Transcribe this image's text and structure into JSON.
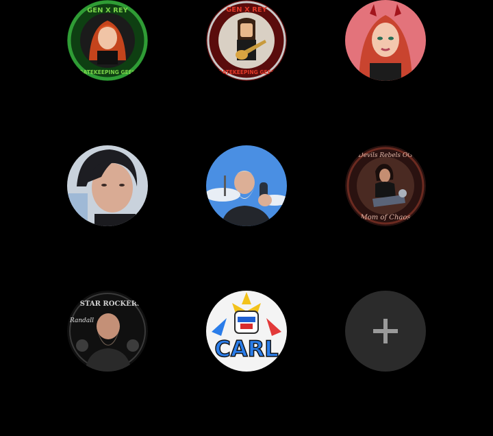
{
  "avatars": [
    {
      "id": "avatar-1",
      "icon": "green-badge-redhead-portrait",
      "ring_color": "#1f8f2a",
      "top_text": "GEN X REY",
      "bottom_text": "GATEKEEPING GEEK"
    },
    {
      "id": "avatar-2",
      "icon": "red-badge-guitarist-figure",
      "ring_color": "#b01a1a",
      "top_text": "GEN X REY",
      "bottom_text": "GATEKEEPING GEEK"
    },
    {
      "id": "avatar-3",
      "icon": "cartoon-devil-girl-portrait",
      "ring_color": "#d8646e"
    },
    {
      "id": "avatar-4",
      "icon": "woman-dark-hair-photo",
      "ring_color": "#bfc8d3"
    },
    {
      "id": "avatar-5",
      "icon": "bearded-man-blue-sky-photo",
      "ring_color": "#4b8fe0"
    },
    {
      "id": "avatar-6",
      "icon": "devils-rebels-badge",
      "ring_color": "#3a1a16",
      "top_text": "Devils Rebels OG",
      "bottom_text": "Mom of Chaos"
    },
    {
      "id": "avatar-7",
      "icon": "star-rockers-bald-man-badge",
      "ring_color": "#1e1e1e",
      "top_text": "STAR ROCKERS",
      "side_text": "Randall"
    },
    {
      "id": "avatar-8",
      "icon": "robot-mech-carl-badge",
      "ring_color": "#ffffff",
      "bottom_text": "CARL"
    }
  ],
  "add_button": {
    "icon": "plus-icon",
    "background": "#2b2b2b",
    "glyph_color": "#9a9a9a"
  },
  "colors": {
    "background": "#000000"
  }
}
